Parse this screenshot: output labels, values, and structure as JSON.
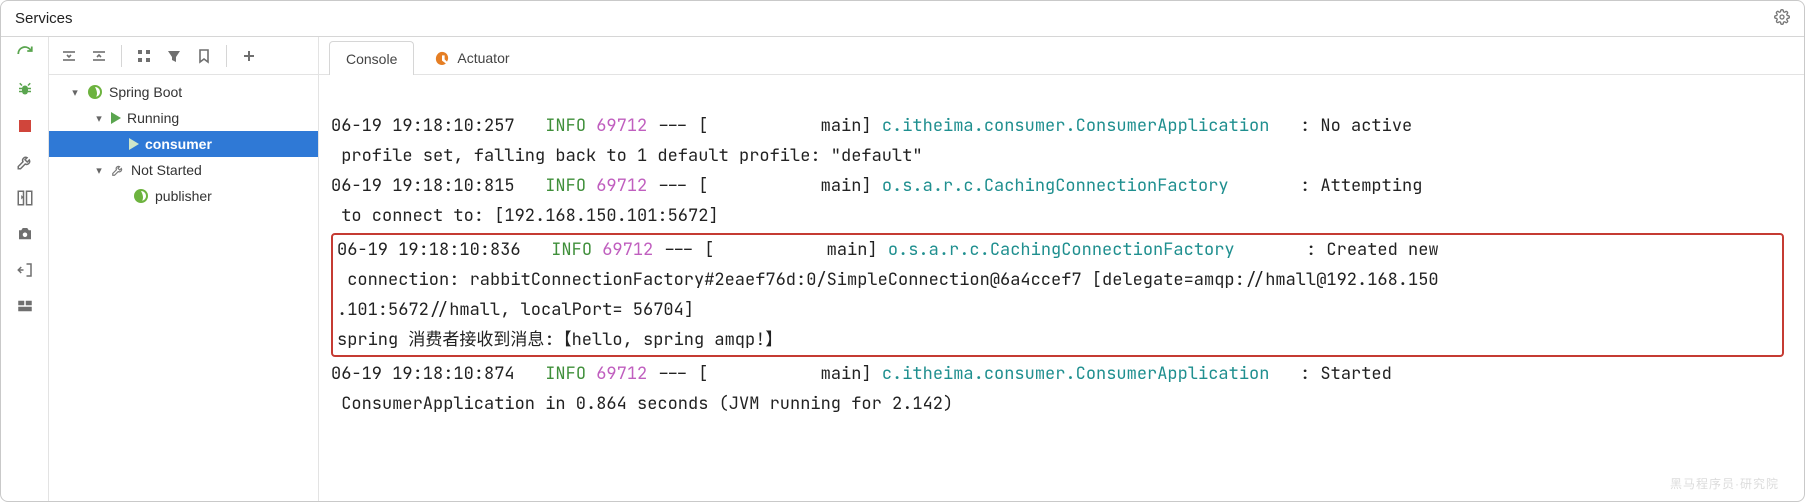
{
  "window": {
    "title": "Services"
  },
  "tree": {
    "root_label": "Spring Boot",
    "running_label": "Running",
    "consumer_label": "consumer",
    "notstarted_label": "Not Started",
    "publisher_label": "publisher"
  },
  "tabs": {
    "console": "Console",
    "actuator": "Actuator"
  },
  "log": {
    "l1": {
      "ts": "06-19 19:18:10:257",
      "lvl": " INFO",
      "pid": "69712",
      "dash": " --- [",
      "thr": "           main] ",
      "cls": "c.itheima.consumer.ConsumerApplication   ",
      "msg": ": No active"
    },
    "l1b": " profile set, falling back to 1 default profile: \"default\"",
    "l2": {
      "ts": "06-19 19:18:10:815",
      "lvl": " INFO",
      "pid": "69712",
      "dash": " --- [",
      "thr": "           main] ",
      "cls": "o.s.a.r.c.CachingConnectionFactory       ",
      "msg": ": Attempting"
    },
    "l2b": " to connect to: [192.168.150.101:5672]",
    "l3": {
      "ts": "06-19 19:18:10:836",
      "lvl": " INFO",
      "pid": "69712",
      "dash": " --- [",
      "thr": "           main] ",
      "cls": "o.s.a.r.c.CachingConnectionFactory       ",
      "msg": ": Created new"
    },
    "l3b": " connection: rabbitConnectionFactory#2eaef76d:0/SimpleConnection@6a4ccef7 [delegate=amqp://hmall@192.168.150",
    "l3c": ".101:5672//hmall, localPort= 56704]",
    "l4": "spring 消费者接收到消息:【hello, spring amqp!】",
    "l5": {
      "ts": "06-19 19:18:10:874",
      "lvl": " INFO",
      "pid": "69712",
      "dash": " --- [",
      "thr": "           main] ",
      "cls": "c.itheima.consumer.ConsumerApplication   ",
      "msg": ": Started"
    },
    "l5b": " ConsumerApplication in 0.864 seconds (JVM running for 2.142)"
  },
  "watermark": "黑马程序员·研究院"
}
